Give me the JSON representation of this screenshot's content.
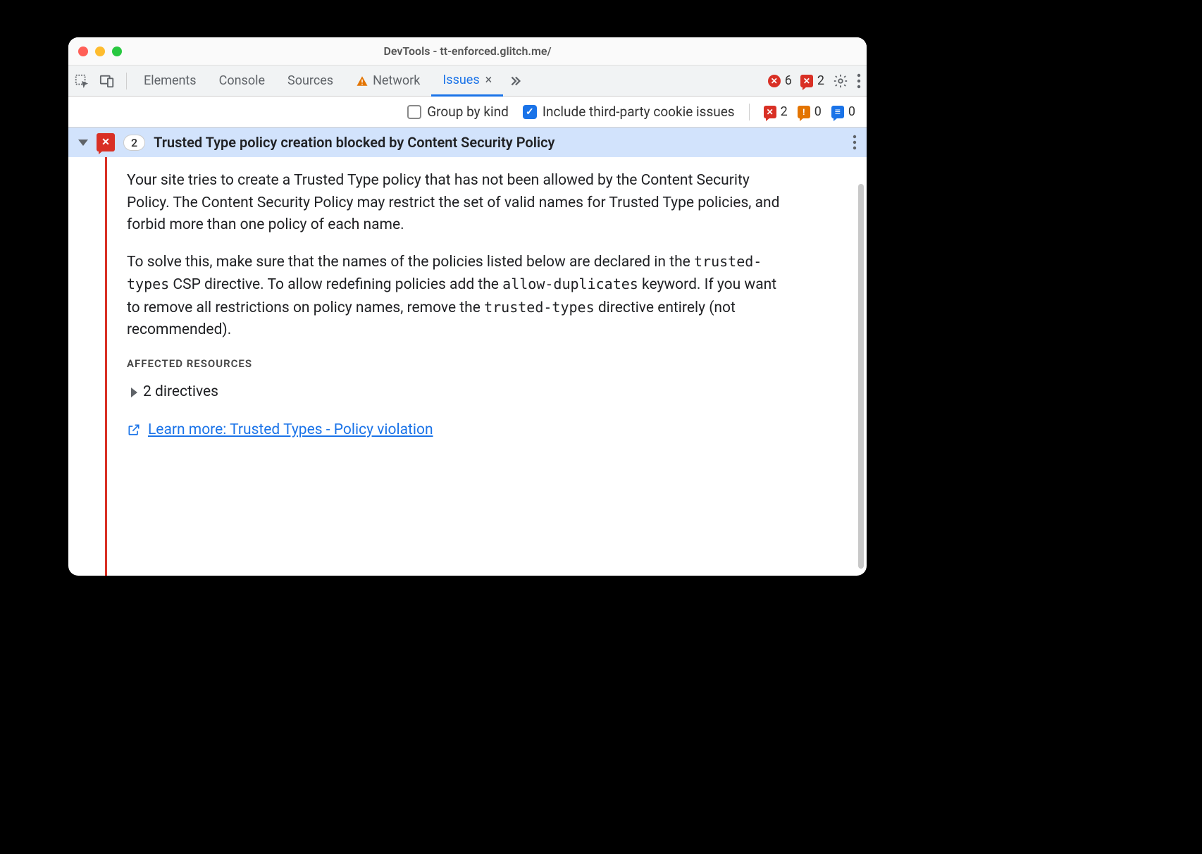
{
  "window": {
    "title": "DevTools - tt-enforced.glitch.me/"
  },
  "tabs": {
    "elements": "Elements",
    "console": "Console",
    "sources": "Sources",
    "network": "Network",
    "issues": "Issues"
  },
  "topCounts": {
    "errors": "6",
    "issueErrors": "2"
  },
  "subbar": {
    "groupByKind": "Group by kind",
    "includeThirdParty": "Include third-party cookie issues",
    "counts": {
      "red": "2",
      "orange": "0",
      "blue": "0"
    }
  },
  "issue": {
    "count": "2",
    "title": "Trusted Type policy creation blocked by Content Security Policy",
    "para1": "Your site tries to create a Trusted Type policy that has not been allowed by the Content Security Policy. The Content Security Policy may restrict the set of valid names for Trusted Type policies, and forbid more than one policy of each name.",
    "para2a": "To solve this, make sure that the names of the policies listed below are declared in the ",
    "code1": "trusted-types",
    "para2b": " CSP directive. To allow redefining policies add the ",
    "code2": "allow-duplicates",
    "para2c": " keyword. If you want to remove all restrictions on policy names, remove the ",
    "code3": "trusted-types",
    "para2d": " directive entirely (not recommended).",
    "affectedLabel": "AFFECTED RESOURCES",
    "directives": "2 directives",
    "learnMore": "Learn more: Trusted Types - Policy violation"
  }
}
